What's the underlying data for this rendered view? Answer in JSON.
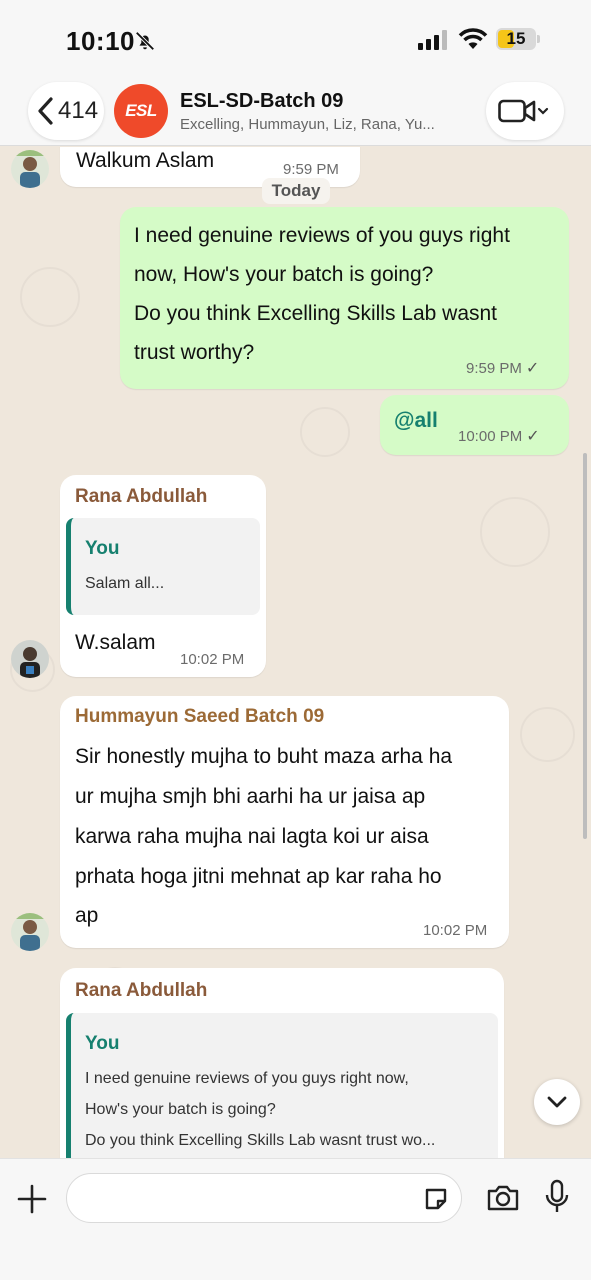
{
  "status": {
    "time": "10:10",
    "battery": "15"
  },
  "header": {
    "back_count": "414",
    "avatar_text": "ESL",
    "group_name": "ESL-SD-Batch 09",
    "members": "Excelling, Hummayun, Liz, Rana, Yu..."
  },
  "chat": {
    "prev_message": {
      "text": "Walkum Aslam",
      "time": "9:59 PM"
    },
    "date_separator": "Today",
    "out1": {
      "lines": [
        "I need genuine reviews of you guys right",
        "now, How's your batch is going?",
        "Do you think Excelling Skills Lab wasnt",
        "trust worthy?"
      ],
      "time": "9:59 PM"
    },
    "out2": {
      "text": "@all",
      "time": "10:00 PM"
    },
    "reply1": {
      "sender": "Rana Abdullah",
      "quote_author": "You",
      "quote_text": "Salam all...",
      "text": "W.salam",
      "time": "10:02 PM"
    },
    "hummayun": {
      "sender": "Hummayun Saeed Batch 09",
      "lines": [
        "Sir honestly mujha to buht maza arha ha",
        "ur mujha smjh bhi aarhi ha ur jaisa ap",
        "karwa raha mujha nai lagta koi ur aisa",
        "prhata hoga jitni mehnat ap kar raha ho",
        "ap"
      ],
      "time": "10:02 PM"
    },
    "reply2": {
      "sender": "Rana Abdullah",
      "quote_author": "You",
      "quote_lines": [
        "I need genuine reviews of you guys right now,",
        "How's your batch is going?",
        "Do you think Excelling Skills Lab wasnt trust wo..."
      ]
    }
  },
  "composer": {
    "placeholder": ""
  },
  "colors": {
    "outgoing_bubble": "#d5fbc7",
    "incoming_bubble": "#ffffff",
    "accent": "#16806f",
    "sender_rana": "#8a5a3a",
    "sender_hummayun": "#9c6a36",
    "brand": "#ef4a2a"
  },
  "icons": [
    "bell-off-icon",
    "signal-icon",
    "wifi-icon",
    "battery-icon",
    "chevron-left-icon",
    "video-icon",
    "chevron-down-icon",
    "plus-icon",
    "sticker-icon",
    "camera-icon",
    "mic-icon",
    "check-icon"
  ]
}
